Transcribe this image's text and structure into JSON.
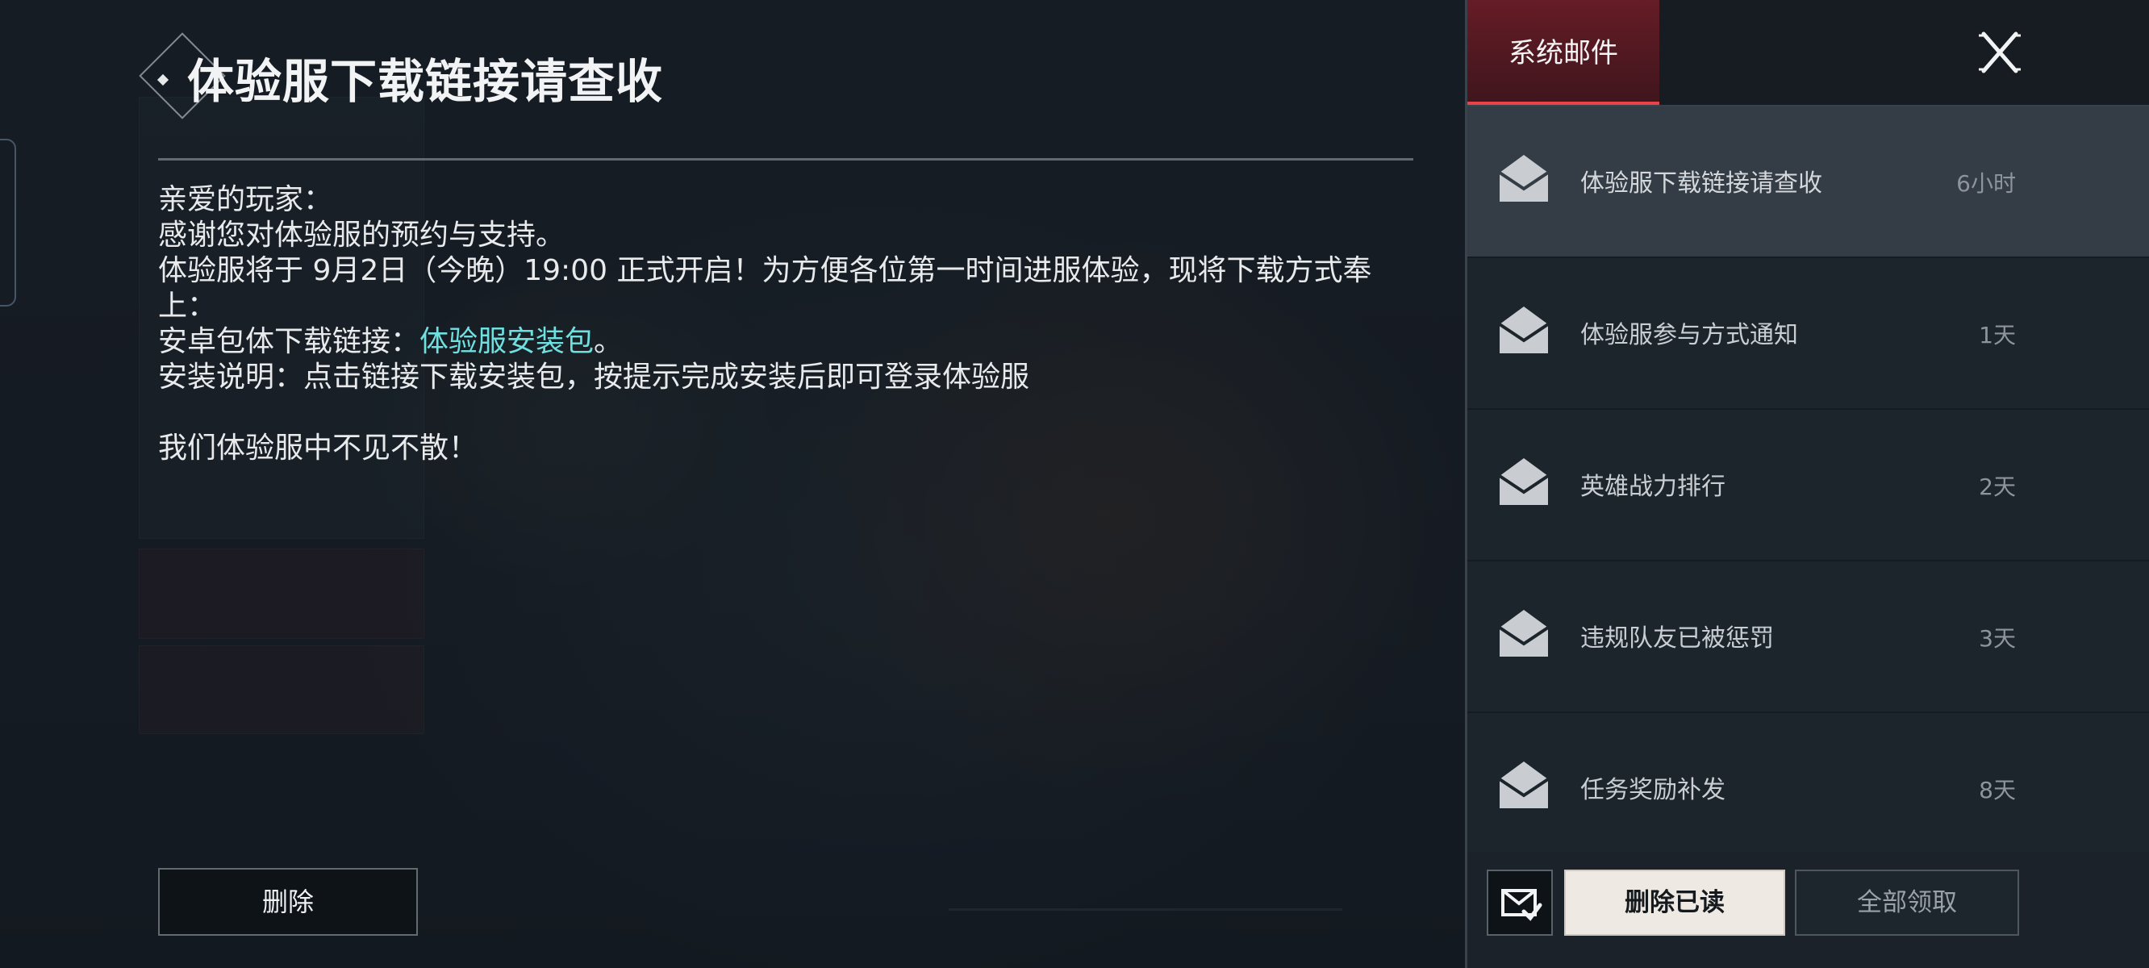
{
  "mail_detail": {
    "title": "体验服下载链接请查收",
    "body": {
      "greeting": "亲爱的玩家：",
      "line1": "感谢您对体验服的预约与支持。",
      "line2": "体验服将于 9月2日（今晚）19:00 正式开启！为方便各位第一时间进服体验，现将下载方式奉上：",
      "line3_prefix": "安卓包体下载链接：",
      "line3_link": "体验服安装包",
      "line3_suffix": "。",
      "line4": "安装说明：点击链接下载安装包，按提示完成安装后即可登录体验服",
      "closing": "我们体验服中不见不散！"
    },
    "delete_label": "删除"
  },
  "panel": {
    "tab_label": "系统邮件",
    "close_icon": "close-icon",
    "mails": [
      {
        "title": "体验服下载链接请查收",
        "time": "6小时",
        "selected": true
      },
      {
        "title": "体验服参与方式通知",
        "time": "1天",
        "selected": false
      },
      {
        "title": "英雄战力排行",
        "time": "2天",
        "selected": false
      },
      {
        "title": "违规队友已被惩罚",
        "time": "3天",
        "selected": false
      },
      {
        "title": "任务奖励补发",
        "time": "8天",
        "selected": false
      }
    ],
    "footer": {
      "check_icon": "mail-check-icon",
      "delete_read_label": "删除已读",
      "claim_all_label": "全部领取"
    }
  },
  "colors": {
    "accent_tab": "#6e1c26",
    "accent_underline": "#e8424a",
    "link": "#6fe0e0",
    "primary_button": "#efe9e3"
  }
}
